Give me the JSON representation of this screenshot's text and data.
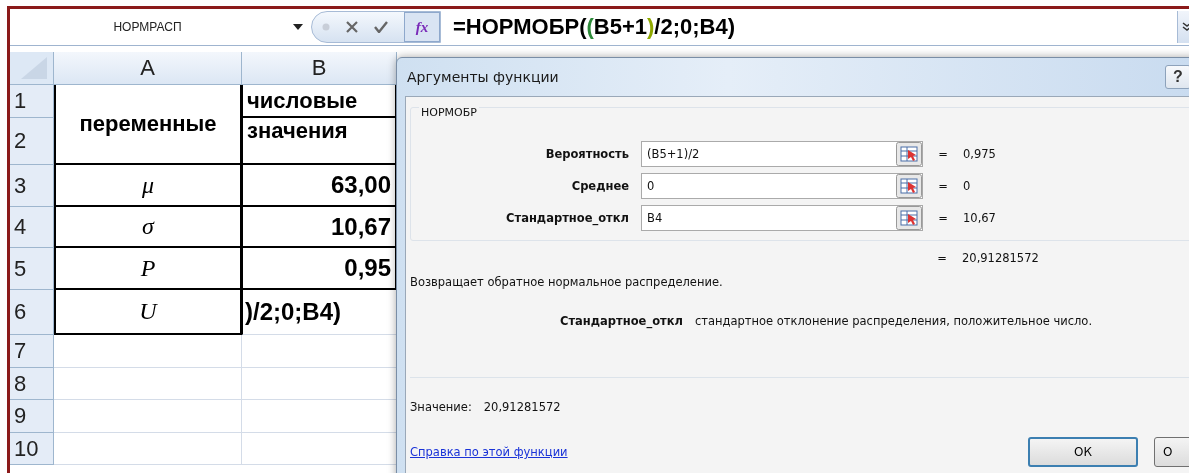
{
  "formula_bar": {
    "name_box": "НОРМРАСП",
    "function_button": "fx",
    "formula": [
      {
        "text": "=НОРМОБР(",
        "color": "#000000"
      },
      {
        "text": "(",
        "color": "#2e8b3a"
      },
      {
        "text": "B5+1",
        "color": "#000000"
      },
      {
        "text": ")",
        "color": "#8fa800"
      },
      {
        "text": "/2;0;B4)",
        "color": "#000000"
      }
    ]
  },
  "sheet": {
    "columns": [
      "A",
      "B"
    ],
    "row_numbers": [
      "1",
      "2",
      "3",
      "4",
      "5",
      "6",
      "7",
      "8",
      "9",
      "10"
    ],
    "header": {
      "variables": "переменные",
      "values_line_1": "числовые",
      "values_line_2": "значения"
    },
    "rows": [
      {
        "variable": "μ",
        "value": "63,00",
        "editing": false
      },
      {
        "variable": "σ",
        "value": "10,67",
        "editing": false
      },
      {
        "variable": "P",
        "value": "0,95",
        "editing": false
      },
      {
        "variable": "U",
        "value": ")/2;0;B4)",
        "editing": true
      }
    ]
  },
  "dialog": {
    "title": "Аргументы функции",
    "help": "?",
    "function_name": "НОРМОБР",
    "arguments": [
      {
        "label": "Вероятность",
        "value": "(B5+1)/2",
        "equals": "=",
        "result": "0,975"
      },
      {
        "label": "Среднее",
        "value": "0",
        "equals": "=",
        "result": "0"
      },
      {
        "label": "Стандартное_откл",
        "value": "B4",
        "equals": "=",
        "result": "10,67"
      }
    ],
    "result_equals": "=",
    "result": "20,91281572",
    "description": "Возвращает обратное нормальное распределение.",
    "argument_help": {
      "name": "Стандартное_откл",
      "text": "стандартное отклонение распределения, положительное число."
    },
    "value_label": "Значение:",
    "value": "20,91281572",
    "help_link": "Справка по этой функции",
    "buttons": [
      {
        "label": "ОК",
        "focused": true
      },
      {
        "label": "О",
        "focused": false
      }
    ]
  }
}
